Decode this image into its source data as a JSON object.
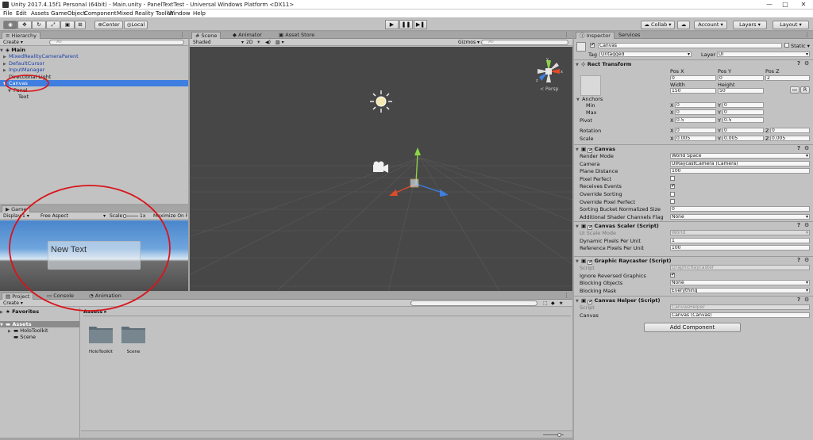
{
  "window": {
    "title": "Unity 2017.4.15f1 Personal (64bit) - Main.unity - PanelTextTest - Universal Windows Platform <DX11>",
    "minimize": "—",
    "maximize": "□",
    "close": "✕"
  },
  "menu": [
    "File",
    "Edit",
    "Assets",
    "GameObject",
    "Component",
    "Mixed Reality Toolkit",
    "Window",
    "Help"
  ],
  "toolbar": {
    "pivot": "Center",
    "space": "Local",
    "collab": "Collab",
    "account": "Account",
    "layers": "Layers",
    "layout": "Layout",
    "play_icons": [
      "▶",
      "❚❚",
      "▶❚"
    ]
  },
  "hierarchy": {
    "tab": "Hierarchy",
    "create": "Create",
    "search": "All",
    "scene": "Main",
    "items": [
      {
        "label": "MixedRealityCameraParent",
        "indent": 1,
        "arrow": "▶",
        "blue": true
      },
      {
        "label": "DefaultCursor",
        "indent": 1,
        "arrow": "▶",
        "blue": true
      },
      {
        "label": "InputManager",
        "indent": 1,
        "arrow": "▶",
        "blue": true
      },
      {
        "label": "Directional Light",
        "indent": 1,
        "arrow": "",
        "blue": false
      },
      {
        "label": "Canvas",
        "indent": 1,
        "arrow": "▼",
        "blue": false,
        "selected": true
      },
      {
        "label": "Panel",
        "indent": 2,
        "arrow": "▼",
        "blue": false
      },
      {
        "label": "Text",
        "indent": 3,
        "arrow": "",
        "blue": false
      }
    ]
  },
  "scene": {
    "tabs": [
      "Scene",
      "Animator",
      "Asset Store"
    ],
    "shading": "Shaded",
    "mode_2d": "2D",
    "gizmos": "Gizmos",
    "search": "All",
    "persp": "Persp"
  },
  "game": {
    "tab": "Game",
    "display": "Display 1",
    "aspect": "Free Aspect",
    "scale": "Scale",
    "scale_value": "1x",
    "maximize": "Maximize On Pl",
    "text": "New Text"
  },
  "project": {
    "tabs": [
      "Project",
      "Console",
      "Animation"
    ],
    "create": "Create",
    "favorites": "Favorites",
    "assets": "Assets",
    "tree": [
      "HoloToolkit",
      "Scene"
    ],
    "breadcrumb": "Assets",
    "folders": [
      "HoloToolkit",
      "Scene"
    ]
  },
  "inspector": {
    "tabs": [
      "Inspector",
      "Services"
    ],
    "object_name": "Canvas",
    "static": "Static",
    "tag_label": "Tag",
    "tag": "Untagged",
    "layer_label": "Layer",
    "layer": "UI",
    "rect": {
      "title": "Rect Transform",
      "posx_l": "Pos X",
      "posy_l": "Pos Y",
      "posz_l": "Pos Z",
      "posx": "0",
      "posy": "0",
      "posz": "2",
      "width_l": "Width",
      "height_l": "Height",
      "width": "150",
      "height": "50",
      "r_button": "R",
      "anchors": "Anchors",
      "min": "Min",
      "max": "Max",
      "min_x": "0",
      "min_y": "0",
      "max_x": "0",
      "max_y": "0",
      "pivot": "Pivot",
      "pivot_x": "0.5",
      "pivot_y": "0.5",
      "rotation": "Rotation",
      "rot_x": "0",
      "rot_y": "0",
      "rot_z": "0",
      "scale": "Scale",
      "sc_x": "0.005",
      "sc_y": "0.005",
      "sc_z": "0.005",
      "x": "X",
      "y": "Y",
      "z": "Z"
    },
    "canvas": {
      "title": "Canvas",
      "rows": [
        {
          "label": "Render Mode",
          "value": "World Space",
          "kind": "dropdown"
        },
        {
          "label": "Camera",
          "value": "UIRaycastCamera (Camera)",
          "kind": "object"
        },
        {
          "label": "Plane Distance",
          "value": "100",
          "kind": "field"
        },
        {
          "label": "Pixel Perfect",
          "value": "",
          "kind": "check"
        },
        {
          "label": "Receives Events",
          "value": "✔",
          "kind": "check"
        },
        {
          "label": "Override Sorting",
          "value": "",
          "kind": "check"
        },
        {
          "label": "Override Pixel Perfect",
          "value": "",
          "kind": "check"
        },
        {
          "label": "Sorting Bucket Normalized Size",
          "value": "0",
          "kind": "field"
        },
        {
          "label": "Additional Shader Channels Flag",
          "value": "None",
          "kind": "dropdown"
        }
      ]
    },
    "scaler": {
      "title": "Canvas Scaler (Script)",
      "rows": [
        {
          "label": "UI Scale Mode",
          "value": "World",
          "kind": "dropdown",
          "grey": true
        },
        {
          "label": "Dynamic Pixels Per Unit",
          "value": "1",
          "kind": "field"
        },
        {
          "label": "Reference Pixels Per Unit",
          "value": "100",
          "kind": "field"
        }
      ]
    },
    "raycaster": {
      "title": "Graphic Raycaster (Script)",
      "rows": [
        {
          "label": "Script",
          "value": "GraphicRaycaster",
          "kind": "object",
          "grey": true
        },
        {
          "label": "Ignore Reversed Graphics",
          "value": "✔",
          "kind": "check"
        },
        {
          "label": "Blocking Objects",
          "value": "None",
          "kind": "dropdown"
        },
        {
          "label": "Blocking Mask",
          "value": "Everything",
          "kind": "dropdown"
        }
      ]
    },
    "helper": {
      "title": "Canvas Helper (Script)",
      "rows": [
        {
          "label": "Script",
          "value": "CanvasHelper",
          "kind": "object",
          "grey": true
        },
        {
          "label": "Canvas",
          "value": "Canvas (Canvas)",
          "kind": "object"
        }
      ]
    },
    "add_component": "Add Component"
  },
  "colors": {
    "selection": "#3d7ee0",
    "annotation": "#d9141b",
    "scene_bg": "#474747",
    "sky": "#5d93d0"
  }
}
